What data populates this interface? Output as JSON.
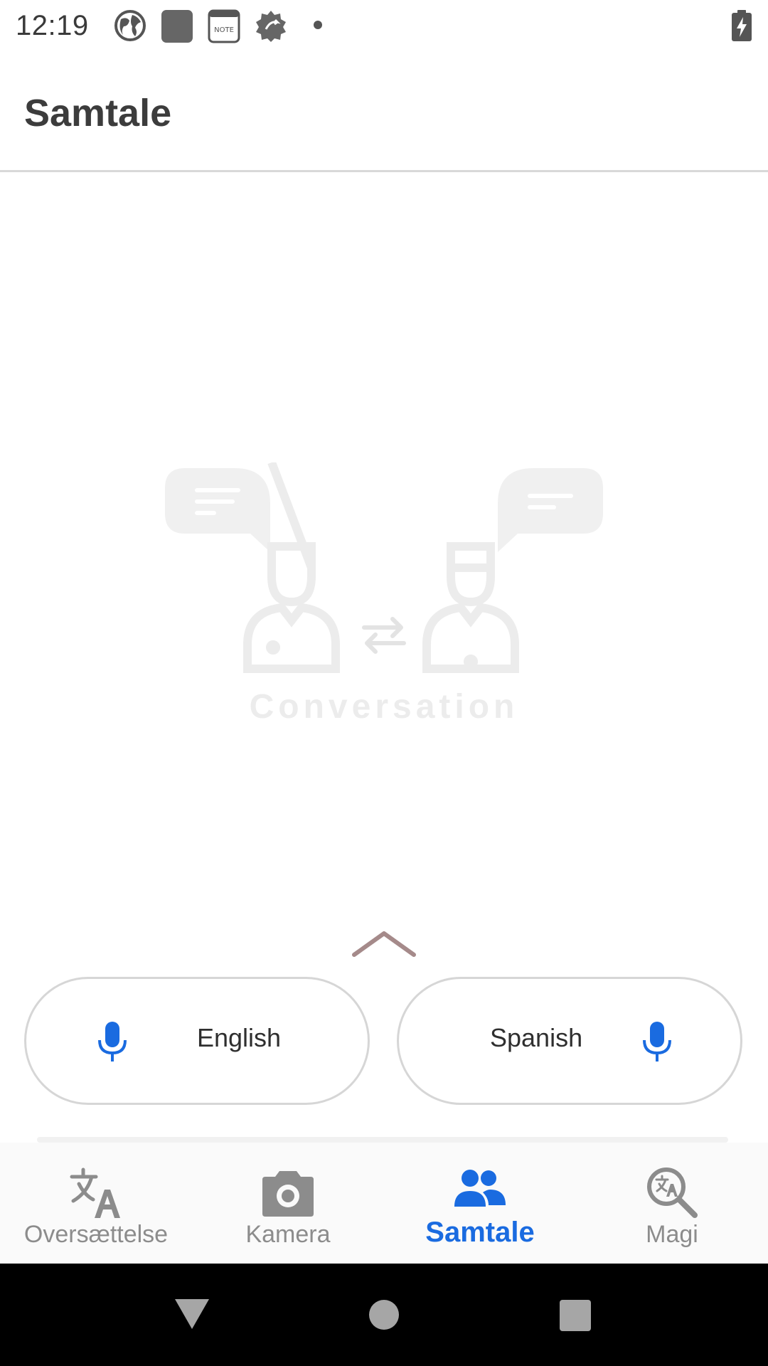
{
  "status_bar": {
    "time": "12:19",
    "icons": [
      "globe-icon",
      "app-square-icon",
      "note-icon",
      "gear-badge-icon",
      "dot-icon"
    ],
    "note_text": "NOTE",
    "battery_icon": "battery-charging-icon"
  },
  "header": {
    "title": "Samtale"
  },
  "illustration": {
    "caption": "Conversation",
    "icons": [
      "left-speech-bubble-icon",
      "right-speech-bubble-icon",
      "left-person-icon",
      "right-person-icon",
      "swap-arrows-icon"
    ]
  },
  "expand": {
    "icon": "chevron-up-icon"
  },
  "languages": {
    "left": {
      "label": "English",
      "icon": "microphone-icon"
    },
    "right": {
      "label": "Spanish",
      "icon": "microphone-icon"
    }
  },
  "bottom_nav": {
    "items": [
      {
        "label": "Oversættelse",
        "icon": "translate-icon",
        "active": false
      },
      {
        "label": "Kamera",
        "icon": "camera-icon",
        "active": false
      },
      {
        "label": "Samtale",
        "icon": "people-icon",
        "active": true
      },
      {
        "label": "Magi",
        "icon": "magnify-translate-icon",
        "active": false
      }
    ]
  },
  "system_nav": {
    "icons": [
      "back-triangle-icon",
      "home-circle-icon",
      "recents-square-icon"
    ]
  },
  "colors": {
    "accent": "#1a6be0",
    "title_text": "#3c3c3c",
    "inactive_nav": "#8c8c8c",
    "pill_border": "#d6d6d6",
    "illustration": "#efefef",
    "chevron": "#a58a8a"
  }
}
